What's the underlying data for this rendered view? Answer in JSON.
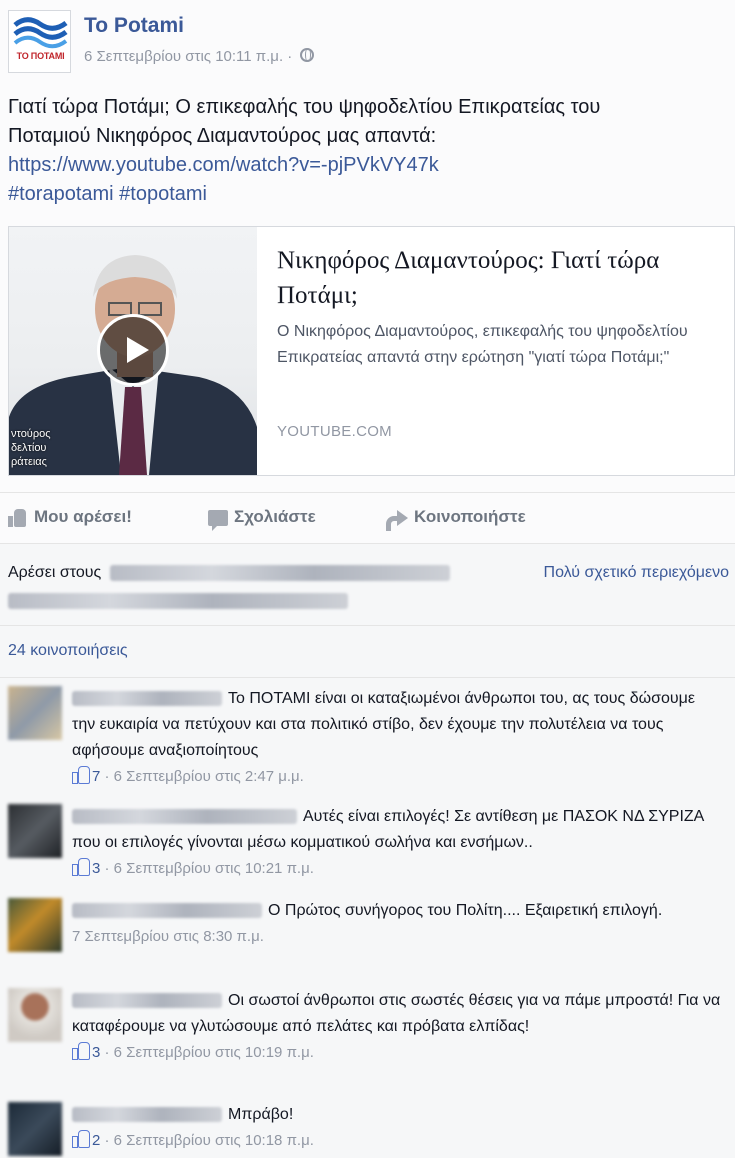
{
  "post": {
    "page_name": "To Potami",
    "logo_text": "ΤΟ ΠΟΤΑΜΙ",
    "timestamp": "6 Σεπτεμβρίου στις 10:11 π.μ. ·",
    "text_line1": "Γιατί τώρα Ποτάμι; Ο επικεφαλής του ψηφοδελτίου Επικρατείας του",
    "text_line2": "Ποταμιού Νικηφόρος Διαμαντούρος μας απαντά:",
    "link": "https://www.youtube.com/watch?v=-pjPVkVY47k",
    "hashtags": "#torapotami #topotami",
    "icons": [
      "page-logo",
      "globe-icon"
    ]
  },
  "preview": {
    "title": "Νικηφόρος Διαμαντούρος: Γιατί τώρα Ποτάμι;",
    "description": "Ο Νικηφόρος Διαμαντούρος, επικεφαλής του ψηφοδελτίου Επικρατείας απαντά στην ερώτηση \"γιατί τώρα Ποτάμι;\"",
    "source": "YOUTUBE.COM",
    "caption_line1": "ντούρος",
    "caption_line2": "δελτίου",
    "caption_line3": "ράτειας",
    "icons": [
      "video-thumbnail",
      "play-icon"
    ]
  },
  "actions": {
    "like": "Μου αρέσει!",
    "comment": "Σχολιάστε",
    "share": "Κοινοποιήστε",
    "icons": [
      "like-icon",
      "comment-icon",
      "share-icon"
    ]
  },
  "likes": {
    "prefix": "Αρέσει στους",
    "relevance": "Πολύ σχετικό περιεχόμενο"
  },
  "shares": "24 κοινοποιήσεις",
  "comments": [
    {
      "text": "Το ΠΟΤΑΜΙ είναι οι καταξιωμένοι άνθρωποι του, ας τους δώσουμε την ευκαιρία να πετύχουν και στα πολιτικό στίβο, δεν έχουμε την πολυτέλεια να τους αφήσουμε αναξιοποίητους",
      "likes": "7",
      "time": " · 6 Σεπτεμβρίου στις 2:47 μ.μ."
    },
    {
      "text": "Αυτές είναι επιλογές! Σε αντίθεση με ΠΑΣΟΚ ΝΔ ΣΥΡΙΖΑ που οι επιλογές γίνονται μέσω κομματικού σωλήνα και ενσήμων..",
      "likes": "3",
      "time": " · 6 Σεπτεμβρίου στις 10:21 π.μ."
    },
    {
      "text": "Ο Πρώτος συνήγορος του Πολίτη.... Εξαιρετική επιλογή.",
      "likes": "",
      "time": "7 Σεπτεμβρίου στις 8:30 π.μ."
    },
    {
      "text": "Οι σωστοί άνθρωποι στις σωστές θέσεις για να πάμε μπροστά! Για να καταφέρουμε να γλυτώσουμε από πελάτες και πρόβατα ελπίδας!",
      "likes": "3",
      "time": " · 6 Σεπτεμβρίου στις 10:19 π.μ."
    },
    {
      "text": "Μπράβο!",
      "likes": "2",
      "time": " · 6 Σεπτεμβρίου στις 10:18 π.μ."
    }
  ],
  "colors": {
    "link_blue": "#3b5998",
    "meta_gray": "#9197a3",
    "brand_red": "#c0262c",
    "brand_blue": "#1e5fb5"
  }
}
